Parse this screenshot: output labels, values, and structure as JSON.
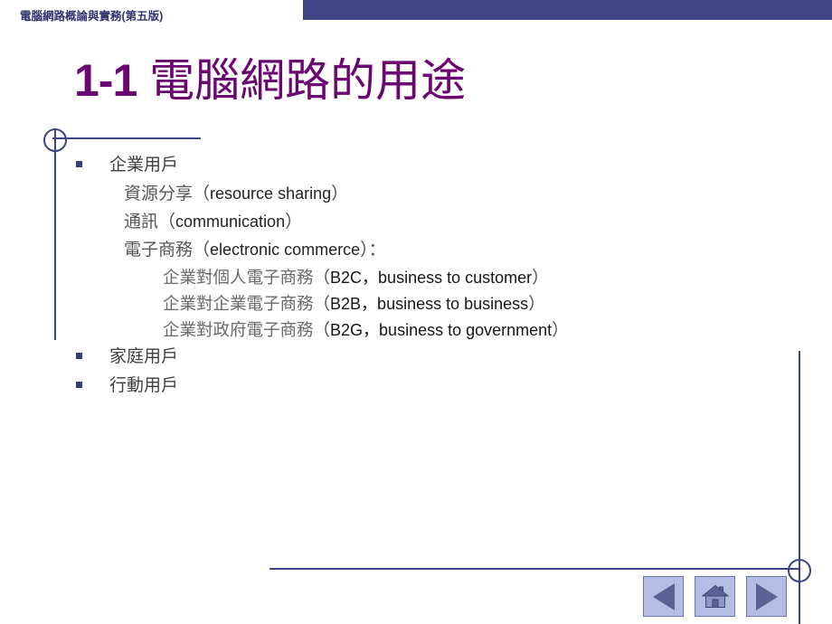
{
  "header": {
    "title": "電腦網路概論與實務(第五版)",
    "bar_color": "#414687"
  },
  "slide": {
    "title_number": "1-1",
    "title_text": "電腦網路的用途",
    "title_color": "#6b0572"
  },
  "content": {
    "bullets": [
      {
        "level": 1,
        "text": "企業用戶"
      },
      {
        "level": 2,
        "cjk": "資源分享",
        "open_paren": "（",
        "en": "resource sharing",
        "close_paren": "）"
      },
      {
        "level": 2,
        "cjk": "通訊",
        "open_paren": "（",
        "en": "communication",
        "close_paren": "）"
      },
      {
        "level": 2,
        "cjk": "電子商務",
        "open_paren": "（",
        "en": "electronic commerce",
        "close_paren": "）："
      },
      {
        "level": 3,
        "cjk": "企業對個人電子商務",
        "open_paren": "（",
        "en": "B2C，business to customer",
        "close_paren": "）"
      },
      {
        "level": 3,
        "cjk": "企業對企業電子商務",
        "open_paren": "（",
        "en": "B2B，business to business",
        "close_paren": "）"
      },
      {
        "level": 3,
        "cjk": "企業對政府電子商務",
        "open_paren": "（",
        "en": "B2G，business to government",
        "close_paren": "）"
      },
      {
        "level": 1,
        "text": "家庭用戶"
      },
      {
        "level": 1,
        "text": "行動用戶"
      }
    ]
  },
  "nav": {
    "previous_label": "previous-slide",
    "home_label": "home-slide",
    "next_label": "next-slide"
  },
  "colors": {
    "accent_blue": "#3c4484",
    "bullet": "#383d7c",
    "nav_fill": "#b6bde4",
    "nav_glyph": "#5b6296"
  }
}
